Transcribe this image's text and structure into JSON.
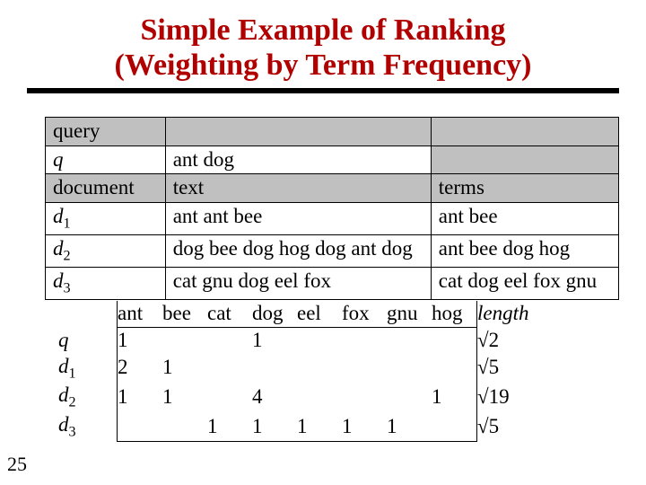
{
  "title_line1": "Simple Example of Ranking",
  "title_line2": "(Weighting by Term Frequency)",
  "page_number": "25",
  "top_table": {
    "r0c0": "query",
    "r1c0": "q",
    "r1c1": "ant dog",
    "r2c0": "document",
    "r2c1": "text",
    "r2c2": "terms",
    "r3c0_base": "d",
    "r3c0_sub": "1",
    "r3c1": "ant ant bee",
    "r3c2": "ant bee",
    "r4c0_base": "d",
    "r4c0_sub": "2",
    "r4c1": "dog bee dog hog dog ant dog",
    "r4c2": "ant bee dog hog",
    "r5c0_base": "d",
    "r5c0_sub": "3",
    "r5c1": "cat gnu dog eel fox",
    "r5c2": "cat dog eel fox gnu"
  },
  "tf_table": {
    "terms": [
      "ant",
      "bee",
      "cat",
      "dog",
      "eel",
      "fox",
      "gnu",
      "hog"
    ],
    "length_label": "length",
    "rows": [
      {
        "label_base": "q",
        "label_sub": "",
        "cells": [
          "1",
          "",
          "",
          "1",
          "",
          "",
          "",
          ""
        ],
        "length": "2"
      },
      {
        "label_base": "d",
        "label_sub": "1",
        "cells": [
          "2",
          "1",
          "",
          "",
          "",
          "",
          "",
          ""
        ],
        "length": "5"
      },
      {
        "label_base": "d",
        "label_sub": "2",
        "cells": [
          "1",
          "1",
          "",
          "4",
          "",
          "",
          "",
          "1"
        ],
        "length": "19"
      },
      {
        "label_base": "d",
        "label_sub": "3",
        "cells": [
          "",
          "",
          "1",
          "1",
          "1",
          "1",
          "1",
          ""
        ],
        "length": "5"
      }
    ]
  },
  "chart_data": {
    "type": "table",
    "title": "Term frequency matrix",
    "columns": [
      "ant",
      "bee",
      "cat",
      "dog",
      "eel",
      "fox",
      "gnu",
      "hog",
      "length"
    ],
    "rows": [
      {
        "label": "q",
        "ant": 1,
        "bee": null,
        "cat": null,
        "dog": 1,
        "eel": null,
        "fox": null,
        "gnu": null,
        "hog": null,
        "length": "√2"
      },
      {
        "label": "d1",
        "ant": 2,
        "bee": 1,
        "cat": null,
        "dog": null,
        "eel": null,
        "fox": null,
        "gnu": null,
        "hog": null,
        "length": "√5"
      },
      {
        "label": "d2",
        "ant": 1,
        "bee": 1,
        "cat": null,
        "dog": 4,
        "eel": null,
        "fox": null,
        "gnu": null,
        "hog": 1,
        "length": "√19"
      },
      {
        "label": "d3",
        "ant": null,
        "bee": null,
        "cat": 1,
        "dog": 1,
        "eel": 1,
        "fox": 1,
        "gnu": 1,
        "hog": null,
        "length": "√5"
      }
    ]
  }
}
